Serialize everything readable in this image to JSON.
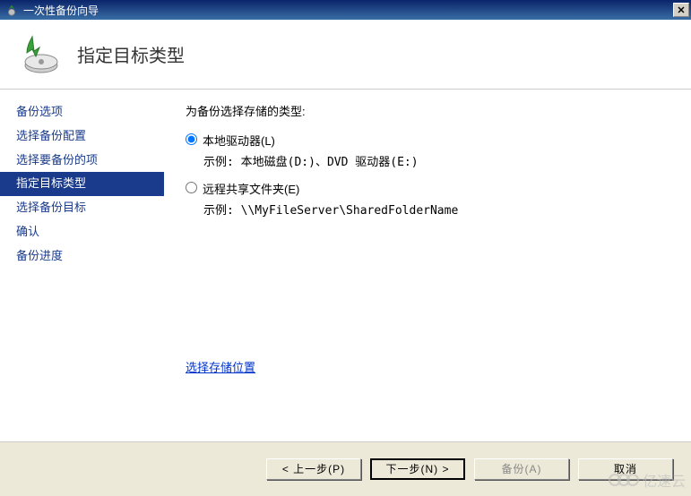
{
  "titlebar": {
    "title": "一次性备份向导"
  },
  "header": {
    "title": "指定目标类型"
  },
  "sidebar": {
    "items": [
      {
        "label": "备份选项"
      },
      {
        "label": "选择备份配置"
      },
      {
        "label": "选择要备份的项"
      },
      {
        "label": "指定目标类型"
      },
      {
        "label": "选择备份目标"
      },
      {
        "label": "确认"
      },
      {
        "label": "备份进度"
      }
    ],
    "active_index": 3
  },
  "main": {
    "instruction": "为备份选择存储的类型:",
    "option1": {
      "label": "本地驱动器(L)",
      "example": "示例: 本地磁盘(D:)、DVD 驱动器(E:)"
    },
    "option2": {
      "label": "远程共享文件夹(E)",
      "example": "示例: \\\\MyFileServer\\SharedFolderName"
    },
    "link": "选择存储位置"
  },
  "footer": {
    "prev": "< 上一步(P)",
    "next": "下一步(N) >",
    "backup": "备份(A)",
    "cancel": "取消"
  },
  "watermark": "亿速云"
}
